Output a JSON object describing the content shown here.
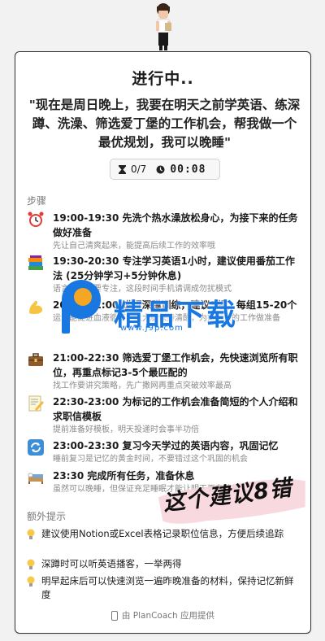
{
  "status": {
    "title": "进行中..",
    "quote": "\"现在是周日晚上，我要在明天之前学英语、练深蹲、洗澡、筛选爱丁堡的工作机会，帮我做一个最优规划，我可以晚睡\"",
    "progress": "0/7",
    "timer": "00:08"
  },
  "steps_label": "步骤",
  "steps": [
    {
      "icon": "alarm-clock-icon",
      "main": "19:00-19:30 先洗个热水澡放松身心，为接下来的任务做好准备",
      "sub": "先让自己清爽起来，能提高后续工作的效率哦"
    },
    {
      "icon": "books-icon",
      "main": "19:30-20:30 专注学习英语1小时，建议使用番茄工作法 (25分钟学习+5分钟休息)",
      "sub": "语言学习需要专注，这段时间手机请调成勿扰模式"
    },
    {
      "icon": "flexed-biceps-icon",
      "main": "20:30-21:00 进行深蹲训练，建议3组，每组15-20个",
      "sub": "运动能促进血液循环，让大脑保持清醒，为接下来的工作做准备"
    },
    {
      "icon": "briefcase-icon",
      "main": "21:00-22:30 筛选爱丁堡工作机会，先快速浏览所有职位，再重点标记3-5个最匹配的",
      "sub": "找工作要讲究策略，先广撒网再重点突破效率最高"
    },
    {
      "icon": "memo-icon",
      "main": "22:30-23:00 为标记的工作机会准备简短的个人介绍和求职信模板",
      "sub": "提前准备好模板，明天投递时会事半功倍"
    },
    {
      "icon": "repeat-icon",
      "main": "23:00-23:30 复习今天学过的英语内容，巩固记忆",
      "sub": "睡前复习是记忆的黄金时间，不要错过这个巩固的机会"
    },
    {
      "icon": "bed-icon",
      "main": "23:30 完成所有任务，准备休息",
      "sub": "虽然可以晚睡，但保证充足睡眠才能让明天更有精神"
    }
  ],
  "tips_label": "额外提示",
  "tips": [
    "建议使用Notion或Excel表格记录职位信息，方便后续追踪",
    "深蹲时可以听英语播客，一举两得",
    "明早起床后可以快速浏览一遍昨晚准备的材料，保持记忆新鲜度"
  ],
  "footer": "由 PlanCoach 应用提供",
  "watermark": {
    "brand": "精品下载",
    "url": "www.j9p.com",
    "stamp": "这个建议8错"
  },
  "colors": {
    "watermark_blue": "#1877e0",
    "watermark_orange": "#f5a623"
  }
}
